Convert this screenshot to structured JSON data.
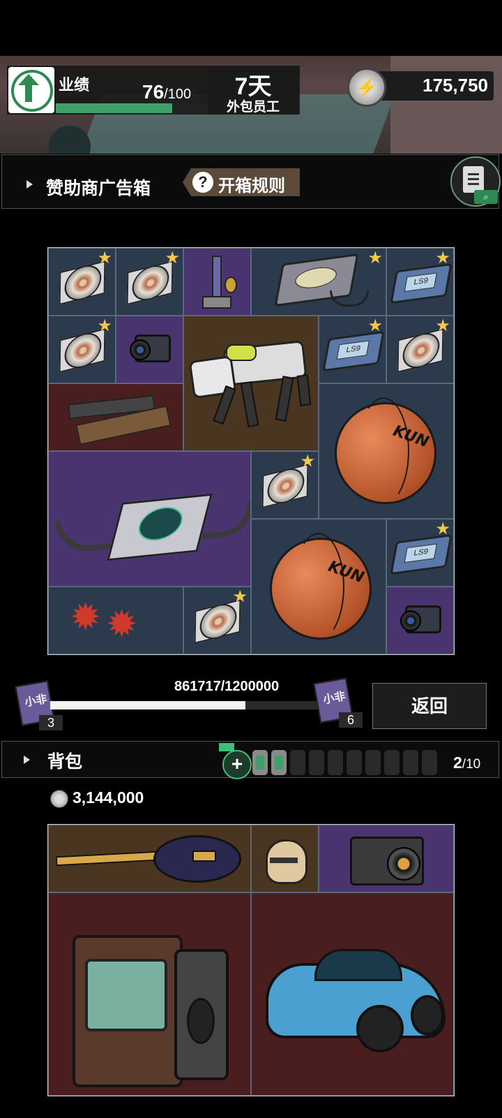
{
  "hud": {
    "performance_label": "业绩",
    "performance_current": "76",
    "performance_max": "/100",
    "performance_fraction": 0.76,
    "days_value": "7天",
    "role_label": "外包员工",
    "energy_value": "175,750"
  },
  "sponsor": {
    "title": "赞助商广告箱",
    "rules_q": "?",
    "rules_label": "开箱规则"
  },
  "box_items": [
    {
      "name": "disc",
      "starred": true
    },
    {
      "name": "disc",
      "starred": true
    },
    {
      "name": "keychain-figure",
      "starred": false
    },
    {
      "name": "disc-player",
      "starred": true
    },
    {
      "name": "handheld-device",
      "starred": true
    },
    {
      "name": "disc",
      "starred": true
    },
    {
      "name": "camera",
      "starred": false
    },
    {
      "name": "robot-dog",
      "starred": false
    },
    {
      "name": "handheld-device",
      "starred": true
    },
    {
      "name": "disc",
      "starred": true
    },
    {
      "name": "wooden-box",
      "starred": false
    },
    {
      "name": "basketball",
      "starred": false
    },
    {
      "name": "radar-device",
      "starred": false
    },
    {
      "name": "disc",
      "starred": true
    },
    {
      "name": "basketball",
      "starred": false
    },
    {
      "name": "handheld-device",
      "starred": true
    },
    {
      "name": "spiky-glasses",
      "starred": false
    },
    {
      "name": "disc",
      "starred": true
    },
    {
      "name": "camera",
      "starred": false
    }
  ],
  "art_text": {
    "ball_brand": "KUN",
    "device_screen": "LS9",
    "ticket_char": "小非"
  },
  "progress": {
    "text": "861717/1200000",
    "fraction": 0.718,
    "left_count": "3",
    "right_count": "6",
    "return_label": "返回"
  },
  "backpack": {
    "title": "背包",
    "add_label": "+",
    "slots_total": 10,
    "slots_filled": 2,
    "count_current": "2",
    "count_max": "/10",
    "coins": "3,144,000",
    "items": [
      "electric-guitar",
      "toy-figure",
      "camera",
      "retro-tv",
      "sports-car"
    ]
  },
  "icons": {
    "gear": "gear-icon",
    "arrow": "arrow-up-icon",
    "energy": "lightning-icon",
    "clipboard": "clipboard-search-icon",
    "star": "star-icon"
  },
  "colors": {
    "star": "#f3c84a",
    "accent_green": "#3fa06a",
    "cell_slate": "#2b3a4c",
    "cell_purple": "#4a3470",
    "cell_brown": "#4a3520",
    "cell_maroon": "#4a1e1e"
  }
}
